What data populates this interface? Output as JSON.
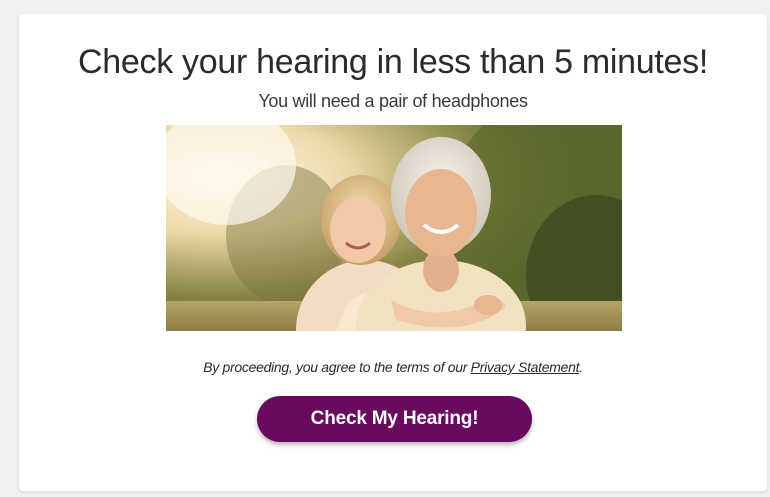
{
  "card": {
    "title": "Check your hearing in less than 5 minutes!",
    "subtitle": "You will need a pair of headphones"
  },
  "photo": {
    "icon": "grandmother-and-child-photo"
  },
  "consent": {
    "prefix": "By proceeding, you agree to the terms of our ",
    "link_label": "Privacy Statement",
    "suffix": "."
  },
  "cta": {
    "label": "Check My Hearing!"
  },
  "colors": {
    "cta_background": "#6a0a5e",
    "cta_text": "#ffffff",
    "page_background": "#f1f1f1",
    "card_background": "#ffffff",
    "text": "#2b2b2b"
  }
}
